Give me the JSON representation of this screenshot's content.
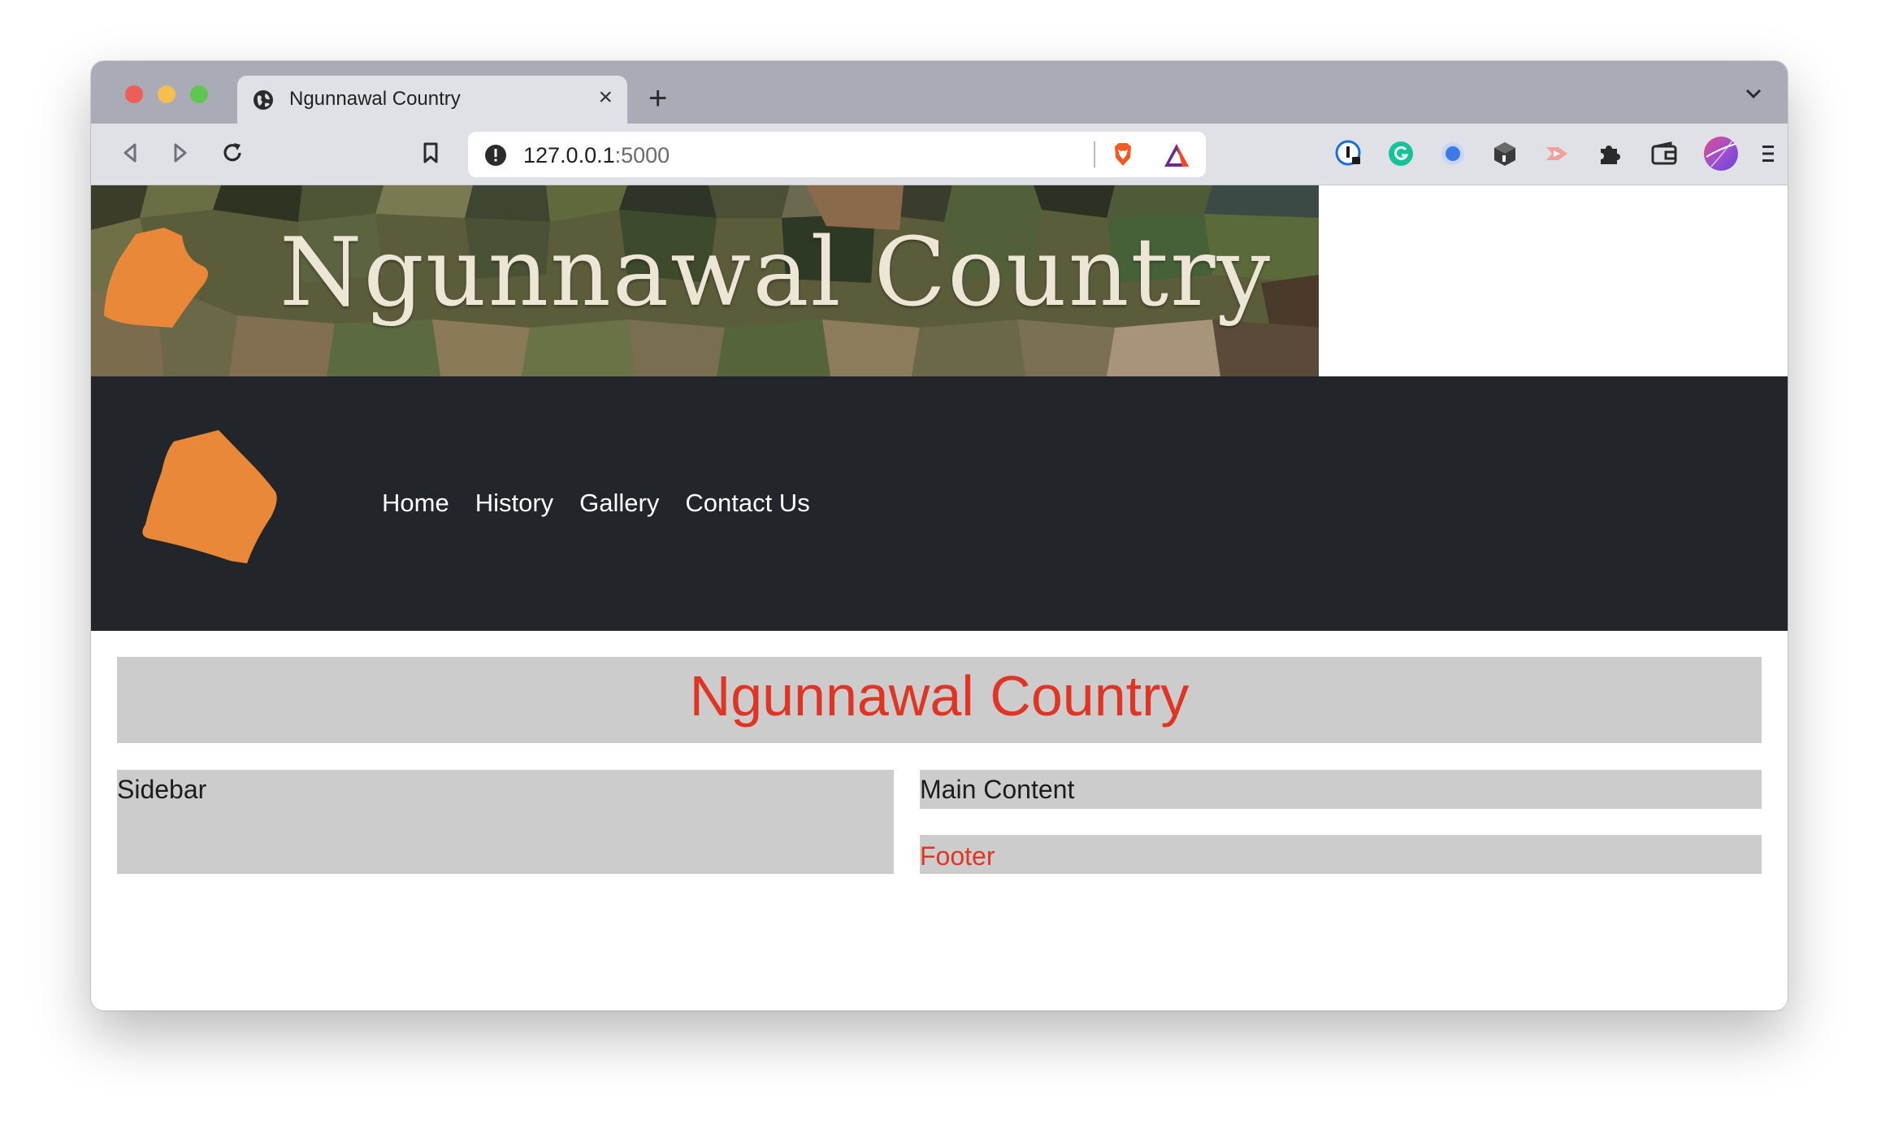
{
  "browser": {
    "tab": {
      "title": "Ngunnawal Country",
      "close": "×"
    },
    "new_tab": "+",
    "address": {
      "host": "127.0.0.1",
      "port": ":5000"
    }
  },
  "banner": {
    "text": "Ngunnawal Country"
  },
  "nav": {
    "links": [
      {
        "label": "Home"
      },
      {
        "label": "History"
      },
      {
        "label": "Gallery"
      },
      {
        "label": "Contact Us"
      }
    ]
  },
  "main_section": {
    "title": "Ngunnawal Country",
    "sidebar": "Sidebar",
    "main_content": "Main Content",
    "footer": "Footer"
  },
  "colors": {
    "accent_orange": "#e98838",
    "title_red": "#e03525",
    "nav_bg": "#22252a",
    "box_gray": "#cccccc"
  },
  "icons": [
    "globe-icon",
    "close-icon",
    "plus-icon",
    "chevron-down-icon",
    "back-icon",
    "forward-icon",
    "reload-icon",
    "bookmark-icon",
    "info-icon",
    "brave-shield-icon",
    "bat-rewards-icon",
    "onepassword-icon",
    "grammarly-icon",
    "blue-dot-extension-icon",
    "cube-extension-icon",
    "arrow-extension-icon",
    "puzzle-icon",
    "wallet-icon",
    "profile-avatar",
    "menu-icon"
  ]
}
